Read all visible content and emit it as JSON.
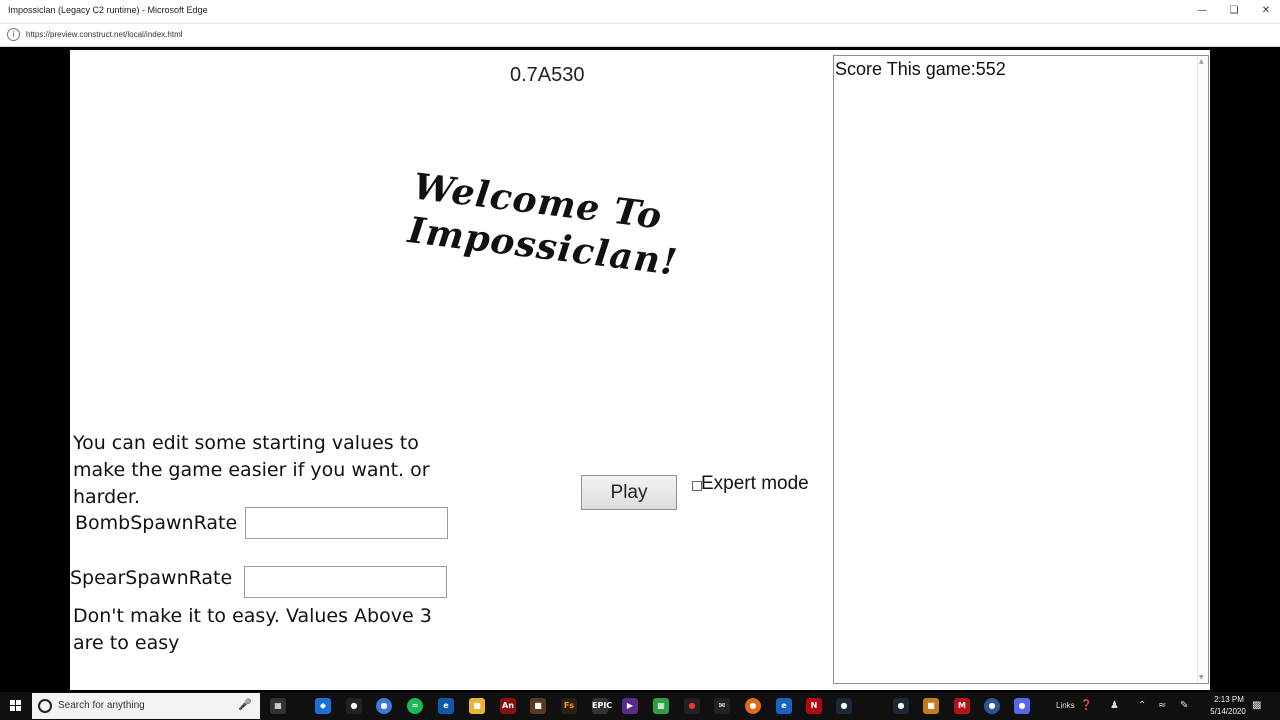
{
  "window": {
    "title": "Impossiclan (Legacy C2 runtime) - Microsoft Edge",
    "url": "https://preview.construct.net/local/index.html"
  },
  "game": {
    "version": "0.7A530",
    "welcome_line1": "Welcome To",
    "welcome_line2": "Impossiclan!",
    "intro_text": "You can edit some starting values to make the game easier if you want. or harder.",
    "bomb_label": "BombSpawnRate",
    "bomb_value": "",
    "spear_label": "SpearSpawnRate",
    "spear_value": "",
    "warning_text": "Don't make it to easy. Values Above 3 are to easy",
    "play_label": "Play",
    "expert_label": "Expert mode",
    "expert_checked": false,
    "score_text": "Score This game:552"
  },
  "taskbar": {
    "search_placeholder": "Search for anything",
    "links_label": "Links",
    "time": "2:13 PM",
    "date": "5/14/2020"
  }
}
